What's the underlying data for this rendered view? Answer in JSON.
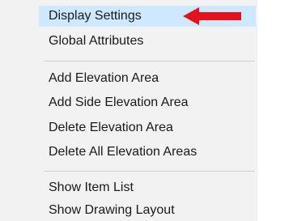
{
  "menu": {
    "items": [
      {
        "label": "Display Settings",
        "highlighted": true
      },
      {
        "label": "Global Attributes"
      },
      {
        "label": "Add Elevation Area"
      },
      {
        "label": "Add Side Elevation Area"
      },
      {
        "label": "Delete Elevation Area"
      },
      {
        "label": "Delete All Elevation Areas"
      },
      {
        "label": "Show Item List"
      },
      {
        "label": "Show Drawing Layout"
      }
    ]
  },
  "annotation": {
    "arrow_icon": "red-arrow-icon",
    "arrow_color": "#e8101a"
  },
  "colors": {
    "menu_background": "#f2f2f2",
    "highlight": "#cde8ff",
    "text": "#1a1a1a",
    "separator": "#cfcfcf"
  }
}
